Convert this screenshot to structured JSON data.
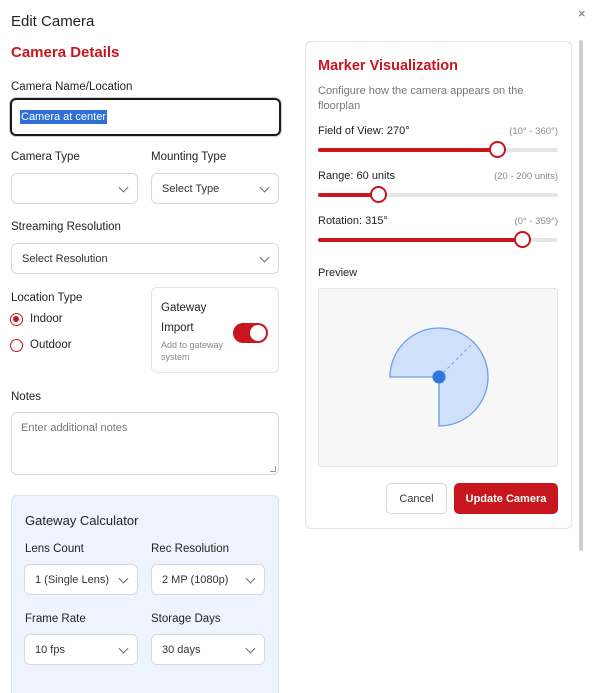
{
  "dialog": {
    "title": "Edit Camera",
    "close_glyph": "×"
  },
  "camera_details": {
    "heading": "Camera Details",
    "name_label": "Camera Name/Location",
    "name_value": "Camera at center",
    "camera_type_label": "Camera Type",
    "camera_type_value": "",
    "mounting_type_label": "Mounting Type",
    "mounting_type_value": "Select Type",
    "streaming_label": "Streaming Resolution",
    "streaming_value": "Select Resolution",
    "location_label": "Location Type",
    "location_options": [
      "Indoor",
      "Outdoor"
    ],
    "location_selected": "Indoor",
    "gateway": {
      "title": "Gateway",
      "import_label": "Import",
      "import_desc": "Add to gateway system",
      "import_on": true
    },
    "notes_label": "Notes",
    "notes_placeholder": "Enter additional notes"
  },
  "gateway_calculator": {
    "heading": "Gateway Calculator",
    "lens_label": "Lens Count",
    "lens_value": "1 (Single Lens)",
    "rec_label": "Rec Resolution",
    "rec_value": "2 MP (1080p)",
    "fps_label": "Frame Rate",
    "fps_value": "10 fps",
    "days_label": "Storage Days",
    "days_value": "30 days"
  },
  "marker": {
    "heading": "Marker Visualization",
    "description": "Configure how the camera appears on the floorplan",
    "fov": {
      "label": "Field of View: 270°",
      "range": "(10° - 360°)",
      "value": 270,
      "min": 10,
      "max": 360,
      "fraction": 0.744
    },
    "range": {
      "label": "Range: 60 units",
      "range": "(20 - 200 units)",
      "value": 60,
      "min": 20,
      "max": 200,
      "fraction": 0.25
    },
    "rotation": {
      "label": "Rotation: 315°",
      "range": "(0° - 359°)",
      "value": 315,
      "min": 0,
      "max": 359,
      "fraction": 0.85
    },
    "preview_label": "Preview"
  },
  "actions": {
    "cancel": "Cancel",
    "update": "Update Camera"
  },
  "colors": {
    "accent": "#c8161e",
    "fov_fill": "#cfe0fa",
    "fov_stroke": "#6c9ee6",
    "dot": "#2f76e0",
    "calc_bg": "#eef4fd"
  }
}
